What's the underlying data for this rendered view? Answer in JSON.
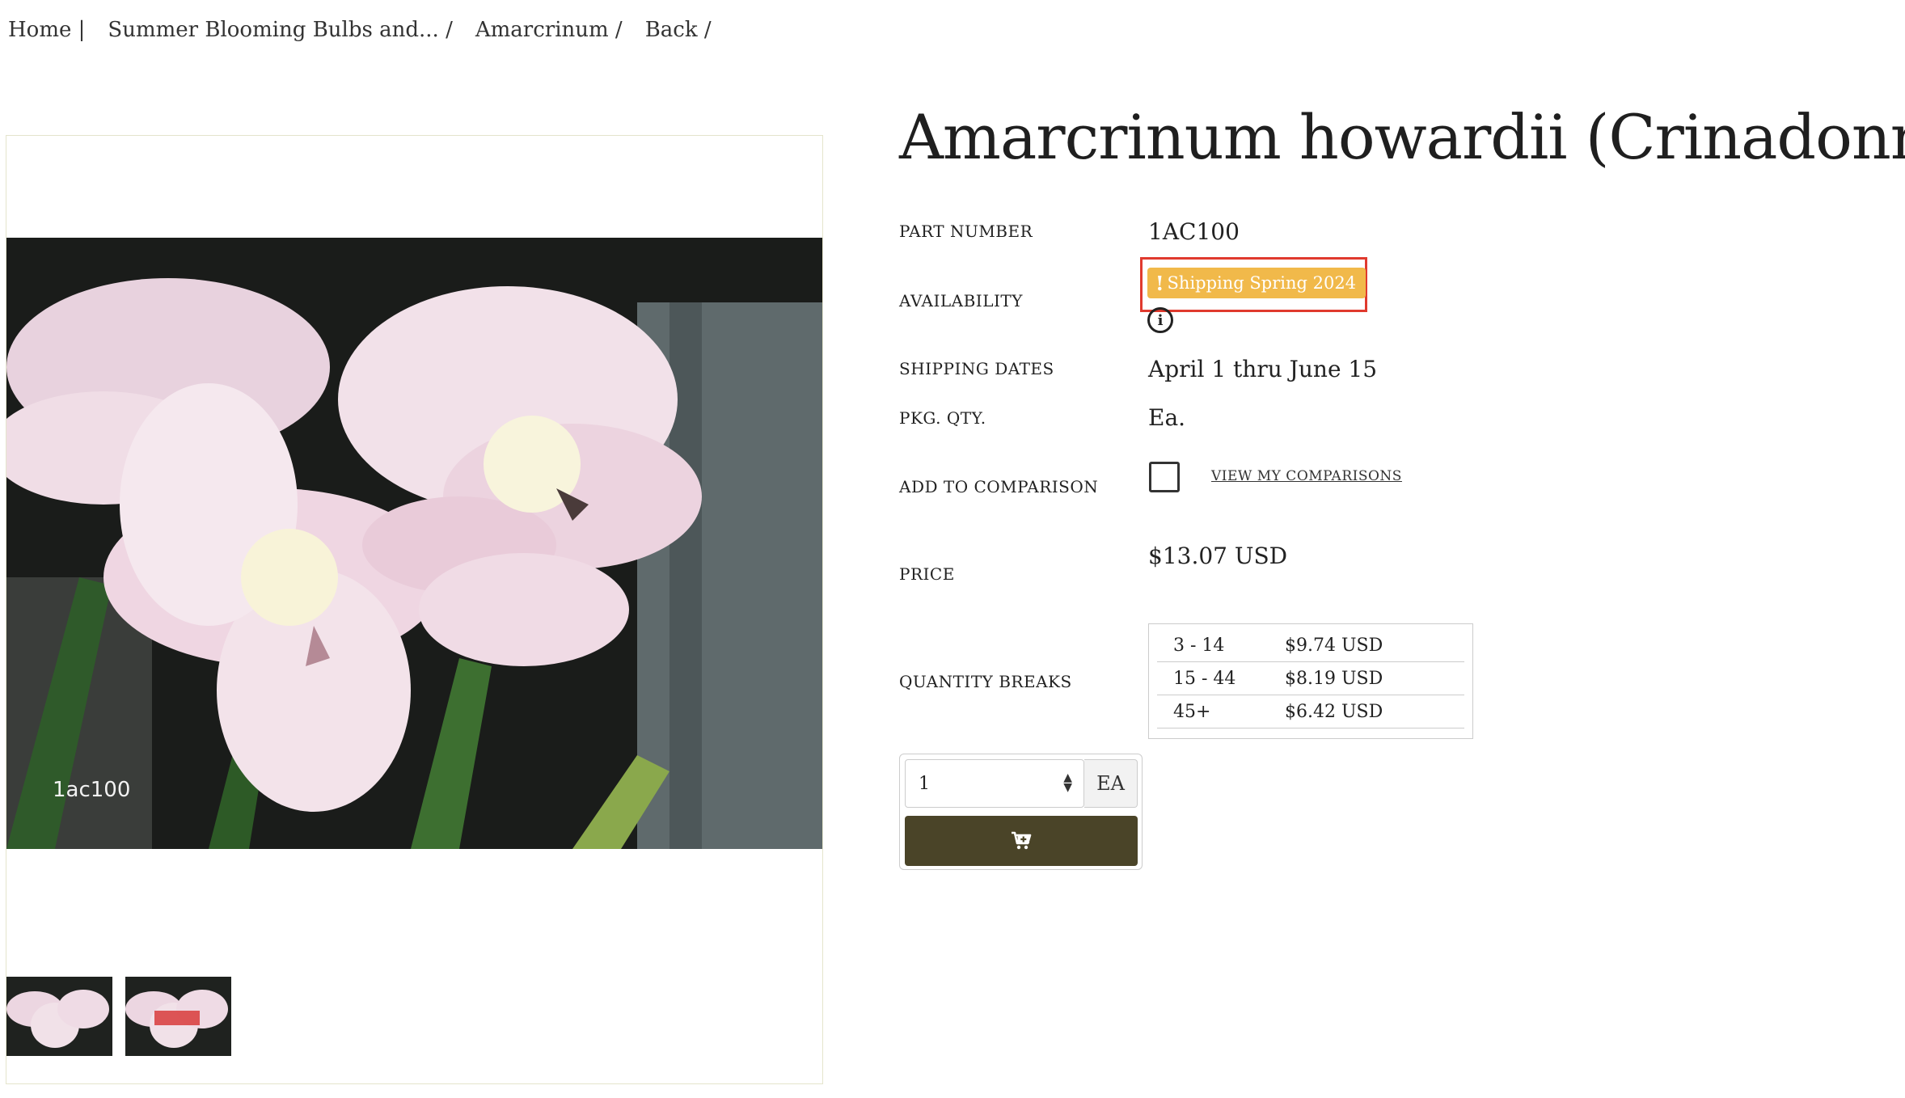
{
  "breadcrumb": {
    "home": "Home |",
    "category": "Summer Blooming Bulbs and... /",
    "genus": "Amarcrinum /",
    "back": "Back /"
  },
  "image": {
    "label": "1ac100"
  },
  "product": {
    "title": "Amarcrinum howardii (Crinadonna)",
    "part_number_label": "PART NUMBER",
    "part_number": "1AC100",
    "availability_label": "AVAILABILITY",
    "availability_badge": "Shipping Spring 2024",
    "availability_badge_mark": "!",
    "shipping_dates_label": "SHIPPING DATES",
    "shipping_dates": "April 1 thru June 15",
    "pkg_qty_label": "PKG. QTY.",
    "pkg_qty": "Ea.",
    "comparison_label": "ADD TO COMPARISON",
    "view_comparisons": "VIEW MY COMPARISONS",
    "price_label": "PRICE",
    "price": "$13.07 USD",
    "quantity_breaks_label": "QUANTITY BREAKS",
    "quantity_breaks": [
      {
        "qty": "3 - 14",
        "price": "$9.74 USD"
      },
      {
        "qty": "15 - 44",
        "price": "$8.19 USD"
      },
      {
        "qty": "45+",
        "price": "$6.42 USD"
      }
    ]
  },
  "cart": {
    "quantity": "1",
    "unit": "EA",
    "button_icon": "cart-plus-icon"
  },
  "colors": {
    "badge": "#f1b94a",
    "highlight_frame": "#e03a2e",
    "cart_button": "#4a4428"
  }
}
